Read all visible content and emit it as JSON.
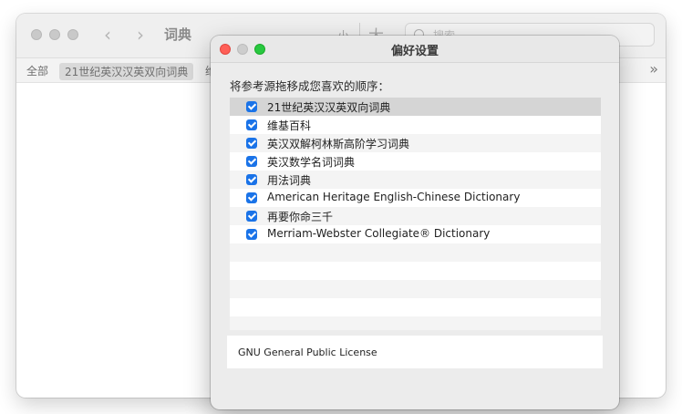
{
  "background_window": {
    "title": "词典",
    "nav": {
      "back": "‹",
      "forward": "›"
    },
    "font_size_small": "小",
    "font_size_large": "大",
    "search_placeholder": "搜索",
    "tabs": [
      {
        "label": "全部",
        "selected": false
      },
      {
        "label": "21世纪英汉汉英双向词典",
        "selected": true
      },
      {
        "label": "维",
        "selected": false
      }
    ],
    "more_glyph": "»"
  },
  "preferences": {
    "title": "偏好设置",
    "instruction": "将参考源拖移成您喜欢的顺序：",
    "sources": [
      {
        "label": "21世纪英汉汉英双向词典",
        "checked": true,
        "selected": true
      },
      {
        "label": "维基百科",
        "checked": true,
        "selected": false
      },
      {
        "label": "英汉双解柯林斯高阶学习词典",
        "checked": true,
        "selected": false
      },
      {
        "label": "英汉数学名词词典",
        "checked": true,
        "selected": false
      },
      {
        "label": "用法词典",
        "checked": true,
        "selected": false
      },
      {
        "label": "American Heritage English-Chinese Dictionary",
        "checked": true,
        "selected": false
      },
      {
        "label": "再要你命三千",
        "checked": true,
        "selected": false
      },
      {
        "label": "Merriam-Webster Collegiate® Dictionary",
        "checked": true,
        "selected": false
      }
    ],
    "license": "GNU General Public License"
  }
}
